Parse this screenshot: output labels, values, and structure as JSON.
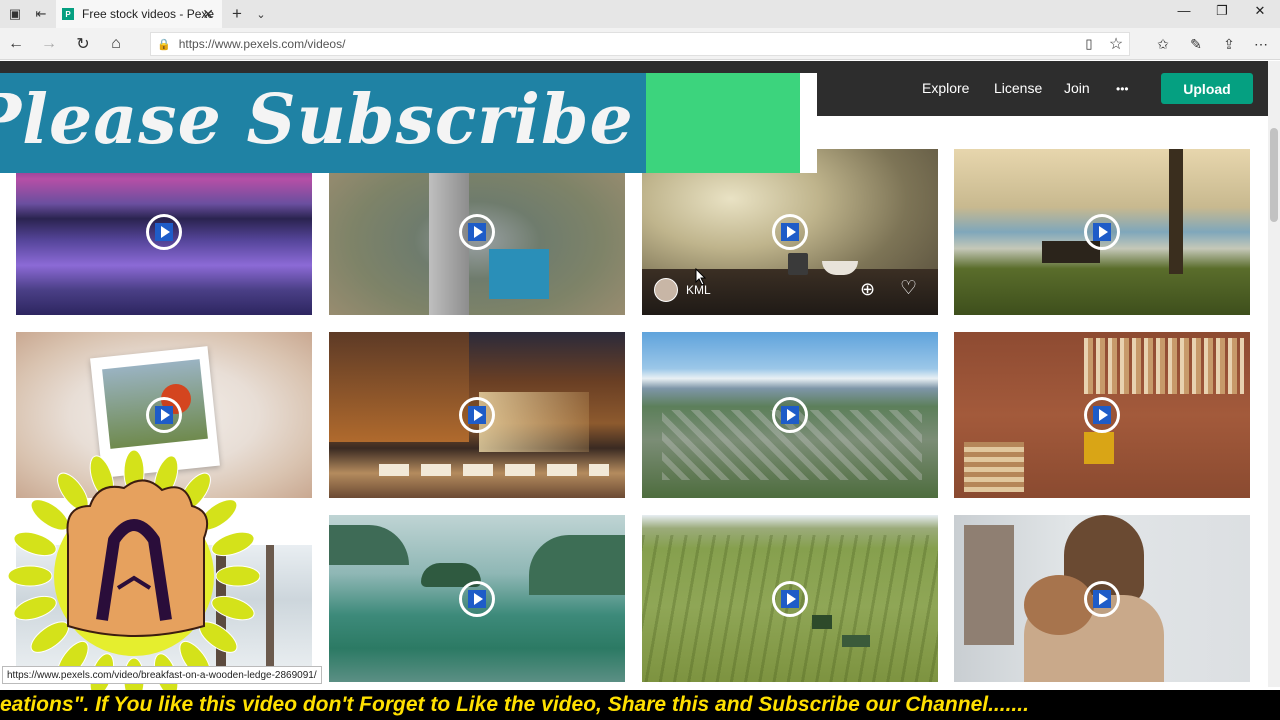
{
  "browser": {
    "tab_title": "Free stock videos - Pexe",
    "tab_favicon_letter": "P",
    "url": "https://www.pexels.com/videos/"
  },
  "site": {
    "nav": [
      "Explore",
      "License",
      "Join"
    ],
    "more": "•••",
    "upload_label": "Upload",
    "accent_color": "#05a081"
  },
  "banner": {
    "text": "Please Subscribe",
    "colors": [
      "#1f82a4",
      "#3cd47d"
    ]
  },
  "hover_author": "KML",
  "status_url": "https://www.pexels.com/video/breakfast-on-a-wooden-ledge-2869091/",
  "ticker": "eations\". If You like this video don't Forget to Like the video, Share this and Subscribe our Channel.......",
  "videos": [
    {
      "subject": "purple lake sunset"
    },
    {
      "subject": "highway interchange aerial"
    },
    {
      "subject": "breakfast on wooden ledge"
    },
    {
      "subject": "bench by misty lake"
    },
    {
      "subject": "flowers in picture frame"
    },
    {
      "subject": "city street at night"
    },
    {
      "subject": "city aerial view"
    },
    {
      "subject": "log pile aerial"
    },
    {
      "subject": "winter forest"
    },
    {
      "subject": "misty island aerial"
    },
    {
      "subject": "tractor in field"
    },
    {
      "subject": "woman holding dog"
    }
  ]
}
